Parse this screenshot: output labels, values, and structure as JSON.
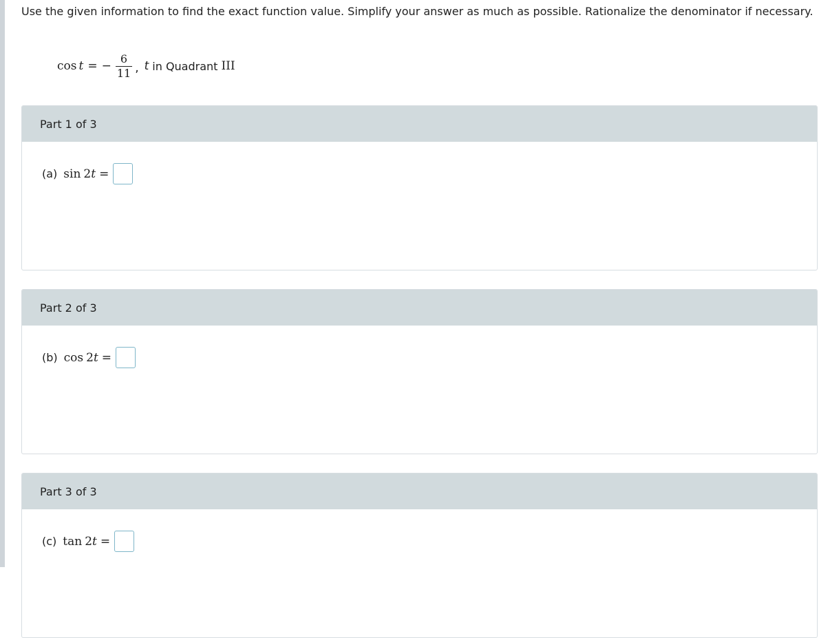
{
  "instructions": "Use the given information to find the exact function value. Simplify your answer as much as possible. Rationalize the denominator if necessary.",
  "given": {
    "function": "cos",
    "variable": "t",
    "equals": "=",
    "sign": "−",
    "numerator": "6",
    "denominator": "11",
    "comma": ",",
    "condition_var": "t",
    "condition_text": "in Quadrant",
    "quadrant": "III"
  },
  "parts": [
    {
      "header": "Part 1 of 3",
      "label": "(a)",
      "function": "sin",
      "coefficient": "2",
      "variable": "t",
      "equals": "="
    },
    {
      "header": "Part 2 of 3",
      "label": "(b)",
      "function": "cos",
      "coefficient": "2",
      "variable": "t",
      "equals": "="
    },
    {
      "header": "Part 3 of 3",
      "label": "(c)",
      "function": "tan",
      "coefficient": "2",
      "variable": "t",
      "equals": "="
    }
  ],
  "colors": {
    "header_bg": "#d1dadd",
    "answer_border": "#7fb6c9",
    "left_rail": "#ced4d9"
  }
}
